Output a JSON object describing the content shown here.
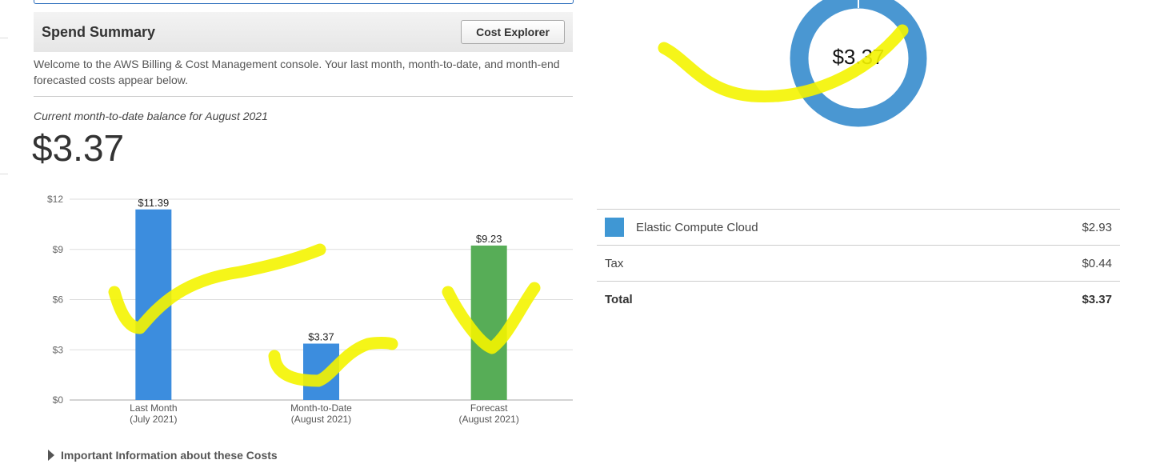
{
  "spend_summary": {
    "title": "Spend Summary",
    "cost_explorer_button": "Cost Explorer",
    "welcome_text": "Welcome to the AWS Billing & Cost Management console. Your last month, month-to-date, and month-end forecasted costs appear below.",
    "balance_label": "Current month-to-date balance for August 2021",
    "balance_amount": "$3.37",
    "important_info": "Important Information about these Costs"
  },
  "chart_data": {
    "type": "bar",
    "categories": [
      "Last Month (July 2021)",
      "Month-to-Date (August 2021)",
      "Forecast (August 2021)"
    ],
    "category_lines": [
      [
        "Last Month",
        "(July 2021)"
      ],
      [
        "Month-to-Date",
        "(August 2021)"
      ],
      [
        "Forecast",
        "(August 2021)"
      ]
    ],
    "values": [
      11.39,
      3.37,
      9.23
    ],
    "value_labels": [
      "$11.39",
      "$3.37",
      "$9.23"
    ],
    "bar_colors": [
      "#3c8dde",
      "#3c8dde",
      "#57ad57"
    ],
    "ylim": [
      0,
      12
    ],
    "yticks": [
      0,
      3,
      6,
      9,
      12
    ],
    "ytick_labels": [
      "$0",
      "$3",
      "$6",
      "$9",
      "$12"
    ],
    "grid": true
  },
  "donut": {
    "total_label": "$3.37",
    "color": "#4a97d2"
  },
  "breakdown": {
    "rows": [
      {
        "label": "Elastic Compute Cloud",
        "value": "$2.93",
        "color": "#3f97d4"
      },
      {
        "label": "Tax",
        "value": "$0.44"
      },
      {
        "label": "Total",
        "value": "$3.37"
      }
    ]
  }
}
